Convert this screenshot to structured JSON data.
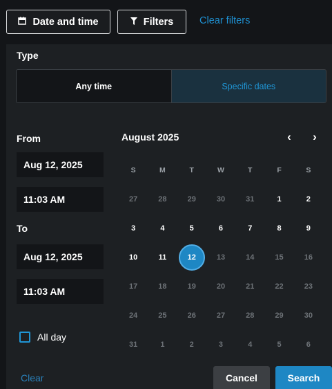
{
  "toolbar": {
    "date_time_label": "Date and time",
    "filters_label": "Filters",
    "clear_filters_label": "Clear filters"
  },
  "type_section": {
    "label": "Type",
    "options": [
      "Any time",
      "Specific dates"
    ],
    "selected": "Specific dates"
  },
  "from": {
    "label": "From",
    "date": "Aug 12, 2025",
    "time": "11:03 AM"
  },
  "to": {
    "label": "To",
    "date": "Aug 12, 2025",
    "time": "11:03 AM"
  },
  "all_day": {
    "label": "All day",
    "checked": false
  },
  "calendar": {
    "month_title": "August 2025",
    "prev_glyph": "‹",
    "next_glyph": "›",
    "weekdays": [
      "S",
      "M",
      "T",
      "W",
      "T",
      "F",
      "S"
    ],
    "weeks": [
      [
        "27",
        "28",
        "29",
        "30",
        "31",
        "1",
        "2"
      ],
      [
        "3",
        "4",
        "5",
        "6",
        "7",
        "8",
        "9"
      ],
      [
        "10",
        "11",
        "12",
        "13",
        "14",
        "15",
        "16"
      ],
      [
        "17",
        "18",
        "19",
        "20",
        "21",
        "22",
        "23"
      ],
      [
        "24",
        "25",
        "26",
        "27",
        "28",
        "29",
        "30"
      ],
      [
        "31",
        "1",
        "2",
        "3",
        "4",
        "5",
        "6"
      ]
    ],
    "selected_day": "12"
  },
  "footer": {
    "clear_label": "Clear",
    "cancel_label": "Cancel",
    "search_label": "Search"
  },
  "colors": {
    "accent": "#1e87c4",
    "link": "#1e8fd0",
    "background": "#131518",
    "panel": "#1d2023"
  }
}
